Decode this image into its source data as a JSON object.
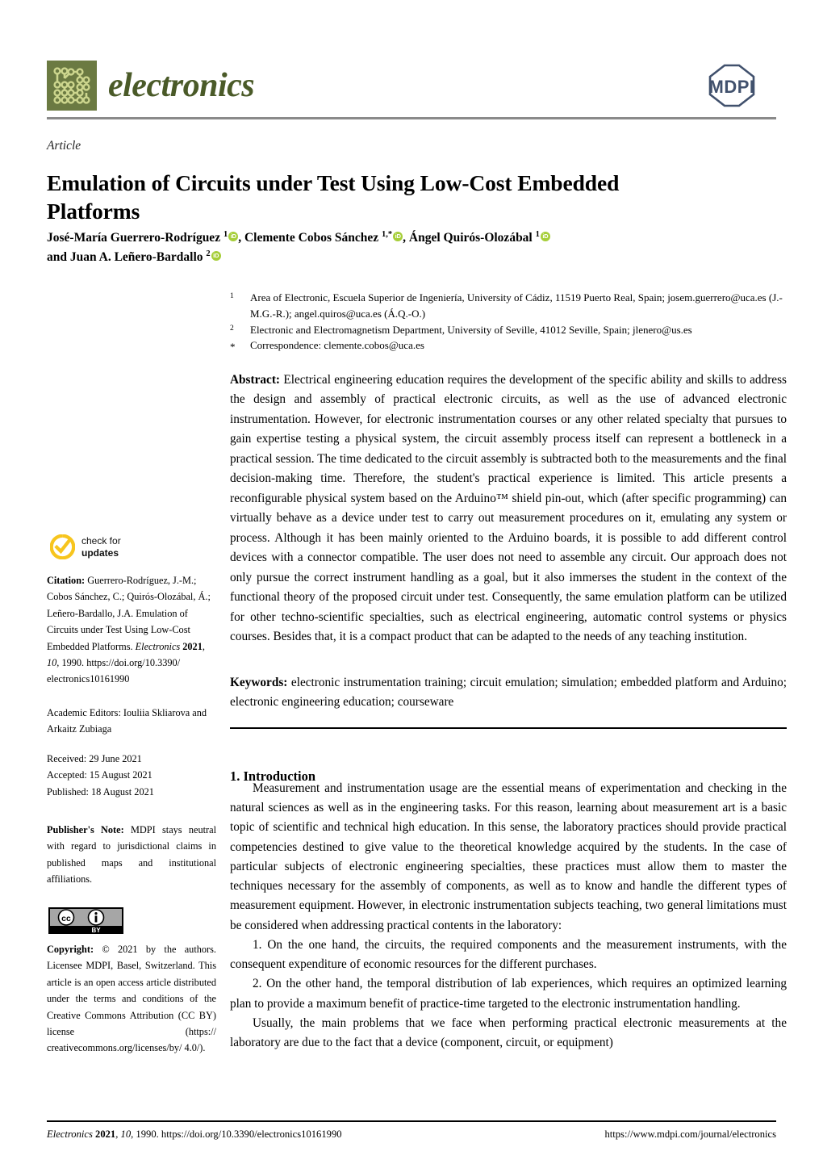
{
  "header": {
    "journal_name": "electronics",
    "publisher_logo_text": "MDPI"
  },
  "article": {
    "type": "Article",
    "title": "Emulation of Circuits under Test Using Low-Cost Embedded Platforms",
    "authors_line1_pre": "José-María Guerrero-Rodríguez ",
    "author1_sup": "1",
    "authors_mid1": ", Clemente Cobos Sánchez ",
    "author2_sup": "1,*",
    "authors_mid2": ", Ángel Quirós-Olozábal ",
    "author3_sup": "1",
    "authors_line2_pre": "and Juan A. Leñero-Bardallo ",
    "author4_sup": "2",
    "orcid_label": "iD"
  },
  "affiliations": [
    {
      "marker": "1",
      "text": "Area of Electronic, Escuela Superior de Ingeniería, University of Cádiz, 11519 Puerto Real, Spain; josem.guerrero@uca.es (J.-M.G.-R.); angel.quiros@uca.es (Á.Q.-O.)"
    },
    {
      "marker": "2",
      "text": "Electronic and Electromagnetism Department, University of Seville, 41012 Seville, Spain; jlenero@us.es"
    },
    {
      "marker": "*",
      "text": "Correspondence: clemente.cobos@uca.es"
    }
  ],
  "abstract": {
    "label": "Abstract:",
    "text": " Electrical engineering education requires the development of the specific ability and skills to address the design and assembly of practical electronic circuits, as well as the use of advanced electronic instrumentation. However, for electronic instrumentation courses or any other related specialty that pursues to gain expertise testing a physical system, the circuit assembly process itself can represent a bottleneck in a practical session. The time dedicated to the circuit assembly is subtracted both to the measurements and the final decision-making time. Therefore, the student's practical experience is limited. This article presents a reconfigurable physical system based on the Arduino™ shield pin-out, which (after specific programming) can virtually behave as a device under test to carry out measurement procedures on it, emulating any system or process. Although it has been mainly oriented to the Arduino boards, it is possible to add different control devices with a connector compatible. The user does not need to assemble any circuit. Our approach does not only pursue the correct instrument handling as a goal, but it also immerses the student in the context of the functional theory of the proposed circuit under test. Consequently, the same emulation platform can be utilized for other techno-scientific specialties, such as electrical engineering, automatic control systems or physics courses. Besides that, it is a compact product that can be adapted to the needs of any teaching institution."
  },
  "keywords": {
    "label": "Keywords:",
    "text": " electronic instrumentation training; circuit emulation; simulation; embedded platform and Arduino; electronic engineering education; courseware"
  },
  "sidebar": {
    "check_for_updates_line1": "check for",
    "check_for_updates_line2": "updates",
    "citation_label": "Citation:",
    "citation_text": "  Guerrero-Rodríguez, J.-M.; Cobos Sánchez, C.; Quirós-Olozábal, Á.; Leñero-Bardallo, J.A. Emulation of Circuits under Test Using Low-Cost Embedded Platforms. ",
    "citation_journal": "Electronics",
    "citation_year": " 2021",
    "citation_volume": ", 10",
    "citation_tail": ", 1990.  https://doi.org/10.3390/ electronics10161990",
    "academic_editors": "Academic Editors: Iouliia Skliarova and Arkaitz Zubiaga",
    "received": "Received: 29 June 2021",
    "accepted": "Accepted: 15 August 2021",
    "published": "Published: 18 August 2021",
    "publishers_note_label": "Publisher's Note:",
    "publishers_note_text": " MDPI stays neutral with regard to jurisdictional claims in published maps and institutional affiliations.",
    "copyright_label": "Copyright:",
    "copyright_text": " © 2021 by the authors. Licensee MDPI, Basel, Switzerland. This article is an open access article distributed under the terms and conditions of the Creative Commons Attribution (CC BY) license (https:// creativecommons.org/licenses/by/ 4.0/).",
    "cc_label": "cc",
    "by_label": "BY"
  },
  "body": {
    "section_heading": "1. Introduction",
    "paragraphs": [
      "Measurement and instrumentation usage are the essential means of experimentation and checking in the natural sciences as well as in the engineering tasks. For this reason, learning about measurement art is a basic topic of scientific and technical high education. In this sense, the laboratory practices should provide practical competencies destined to give value to the theoretical knowledge acquired by the students. In the case of particular subjects of electronic engineering specialties, these practices must allow them to master the techniques necessary for the assembly of components, as well as to know and handle the different types of measurement equipment. However, in electronic instrumentation subjects teaching, two general limitations must be considered when addressing practical contents in the laboratory:",
      "1. On the one hand, the circuits, the required components and the measurement instruments, with the consequent expenditure of economic resources for the different purchases.",
      "2. On the other hand, the temporal distribution of lab experiences, which requires an optimized learning plan to provide a maximum benefit of practice-time targeted to the electronic instrumentation handling.",
      "Usually, the main problems that we face when performing practical electronic measurements at the laboratory are due to the fact that a device (component, circuit, or equipment)"
    ]
  },
  "footer": {
    "left_journal": "Electronics",
    "left_year": " 2021",
    "left_vol": ", 10",
    "left_rest": ", 1990. https://doi.org/10.3390/electronics10161990",
    "right": "https://www.mdpi.com/journal/electronics"
  },
  "colors": {
    "journal_green": "#4a5a28",
    "logo_bg": "#6b7a42",
    "logo_trace": "#cdd68e",
    "mdpi_navy": "#41516d",
    "orcid_green": "#a6ce39",
    "check_yellow": "#f7c51e",
    "rule_gray": "#8a8a8a"
  }
}
